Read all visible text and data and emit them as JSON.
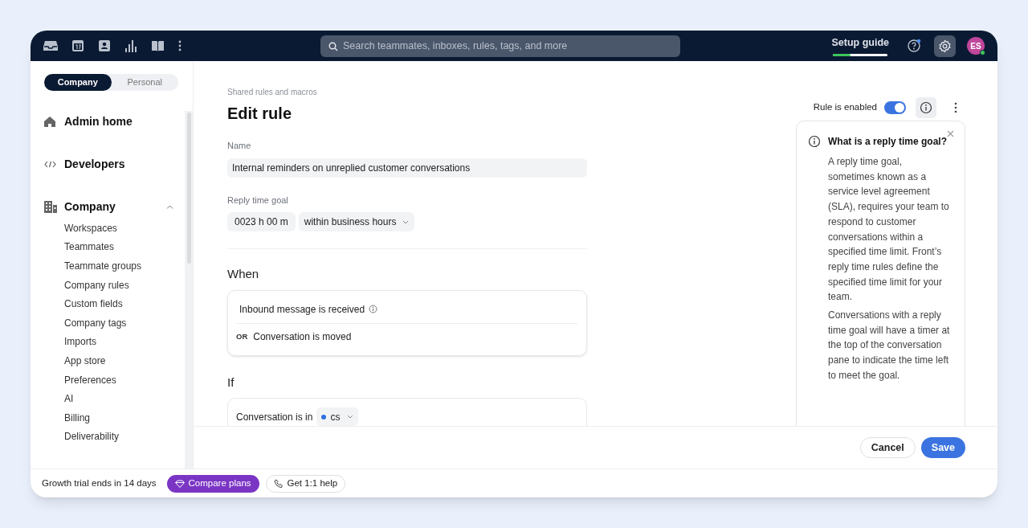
{
  "topbar": {
    "search": {
      "placeholder": "Search teammates, inboxes, rules, tags, and more"
    },
    "setup_guide": {
      "label": "Setup guide",
      "level": 0.32
    },
    "avatar": {
      "initials": "ES"
    }
  },
  "sidebar": {
    "tabs": [
      {
        "label": "Company",
        "selected": true
      },
      {
        "label": "Personal",
        "selected": false
      }
    ],
    "sections": [
      {
        "kind": "home",
        "label": "Admin home"
      },
      {
        "kind": "code",
        "label": "Developers"
      },
      {
        "kind": "building",
        "label": "Company",
        "expanded": true,
        "children": [
          {
            "label": "Workspaces"
          },
          {
            "label": "Teammates"
          },
          {
            "label": "Teammate groups"
          },
          {
            "label": "Company rules"
          },
          {
            "label": "Custom fields"
          },
          {
            "label": "Company tags"
          },
          {
            "label": "Imports"
          },
          {
            "label": "App store"
          },
          {
            "label": "Preferences"
          },
          {
            "label": "AI"
          },
          {
            "label": "Billing"
          },
          {
            "label": "Deliverability"
          }
        ]
      }
    ]
  },
  "main": {
    "breadcrumb": "Shared rules and macros",
    "title": "Edit rule",
    "rule_toggle": {
      "label": "Rule is enabled",
      "on": true
    },
    "name": {
      "label": "Name",
      "value": "Internal reminders on unreplied customer conversations"
    },
    "reply_time_goal": {
      "label": "Reply time goal",
      "value": "0023 h 00 m",
      "mode": "within business hours"
    },
    "when": {
      "heading": "When",
      "conditions": [
        {
          "text": "Inbound message is received",
          "info": true
        },
        {
          "connector": "OR",
          "text": "Conversation is moved",
          "info": false
        }
      ]
    },
    "if": {
      "heading": "If",
      "condition": {
        "text": "Conversation is in",
        "chip": {
          "label": "cs",
          "color": "#2f6fe0"
        }
      }
    },
    "help": {
      "title": "What is a reply time goal?",
      "paragraphs": [
        "A reply time goal, sometimes known as a service level agreement (SLA), requires your team to respond to customer conversations within a specified time limit. Front’s reply time rules define the specified time limit for your team.",
        "Conversations with a reply time goal will have a timer at the top of the conversation pane to indicate the time left to meet the goal."
      ]
    },
    "actions": [
      "Cancel",
      "Save"
    ]
  },
  "footer": {
    "trial": "Growth trial ends in 14 days",
    "buttons": [
      "Compare plans",
      "Get 1:1 help"
    ]
  }
}
